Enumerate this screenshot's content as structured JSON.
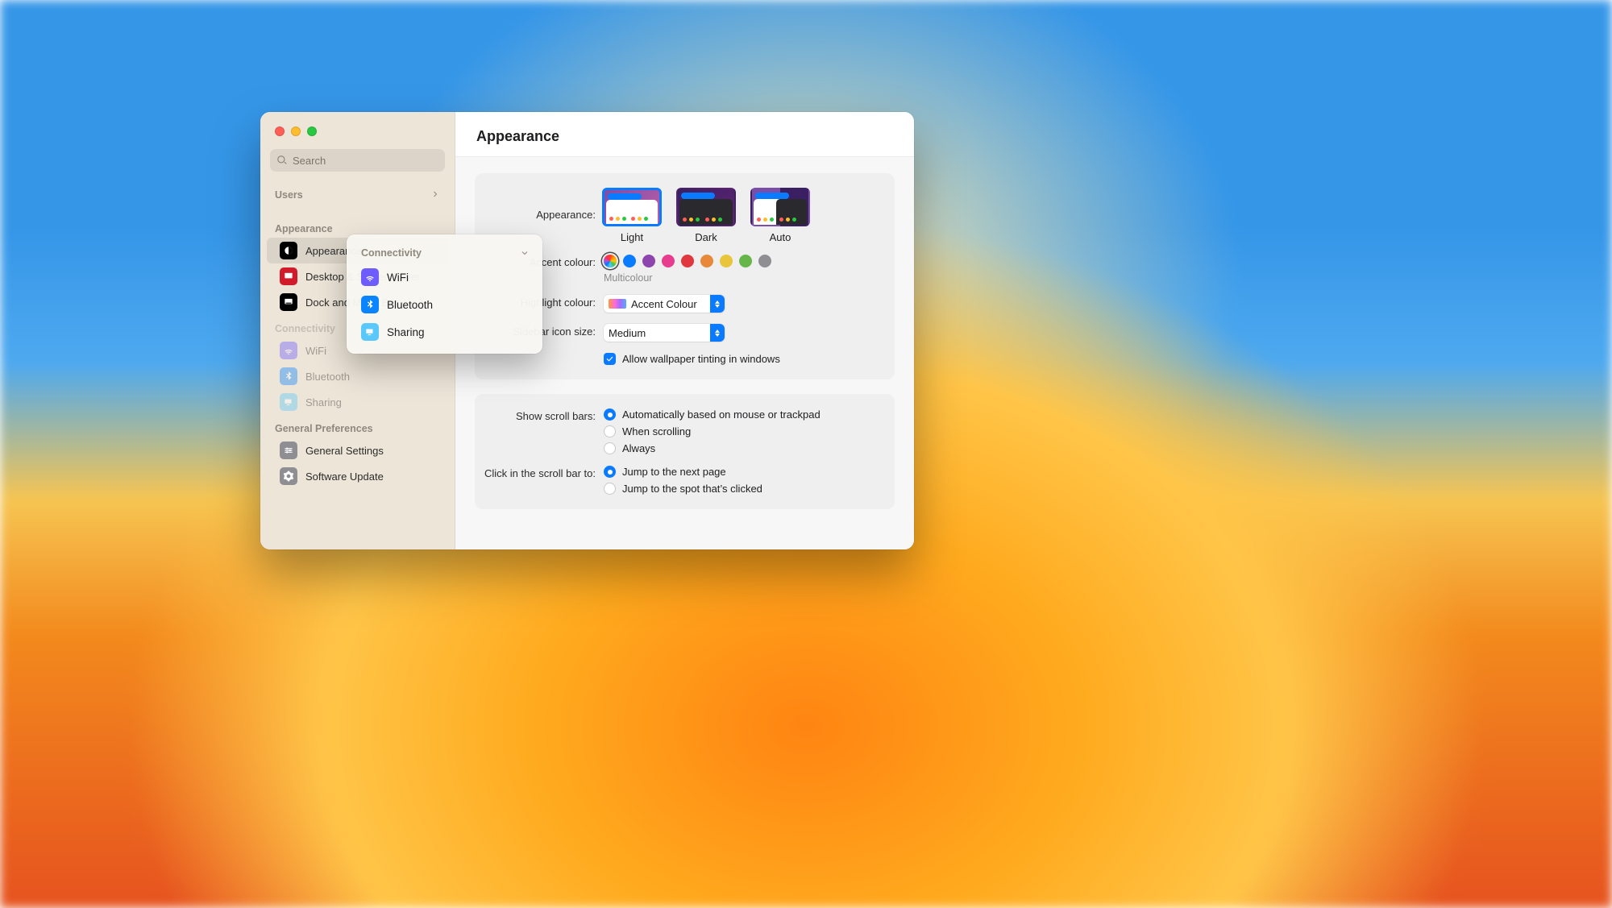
{
  "window": {
    "title": "Appearance"
  },
  "sidebar": {
    "search_placeholder": "Search",
    "users_header": "Users",
    "sections": {
      "appearance": {
        "header": "Appearance",
        "items": [
          {
            "label": "Appearance"
          },
          {
            "label": "Desktop & Screen Saver"
          },
          {
            "label": "Dock and Menu Bar"
          }
        ]
      },
      "connectivity": {
        "header": "Connectivity",
        "items": [
          {
            "label": "WiFi"
          },
          {
            "label": "Bluetooth"
          },
          {
            "label": "Sharing"
          }
        ]
      },
      "general": {
        "header": "General Preferences",
        "items": [
          {
            "label": "General Settings"
          },
          {
            "label": "Software Update"
          }
        ]
      }
    }
  },
  "popover": {
    "header": "Connectivity",
    "items": [
      {
        "label": "WiFi"
      },
      {
        "label": "Bluetooth"
      },
      {
        "label": "Sharing"
      }
    ]
  },
  "main": {
    "appearance_label": "Appearance:",
    "appearance_options": {
      "light": "Light",
      "dark": "Dark",
      "auto": "Auto"
    },
    "accent_label": "Accent colour:",
    "accent_value_name": "Multicolour",
    "accent_colours": [
      "#multicolour",
      "#0a7bff",
      "#8e44ad",
      "#e73c8f",
      "#e0383e",
      "#e8883a",
      "#e8c53a",
      "#67b64b",
      "#8e8e93"
    ],
    "highlight_label": "Highlight colour:",
    "highlight_value": "Accent Colour",
    "sidebaricon_label": "Sidebar icon size:",
    "sidebaricon_value": "Medium",
    "tint_label": "Allow wallpaper tinting in windows",
    "tint_checked": true,
    "scroll_label": "Show scroll bars:",
    "scroll_options": [
      {
        "label": "Automatically based on mouse or trackpad",
        "selected": true
      },
      {
        "label": "When scrolling",
        "selected": false
      },
      {
        "label": "Always",
        "selected": false
      }
    ],
    "click_label": "Click in the scroll bar to:",
    "click_options": [
      {
        "label": "Jump to the next page",
        "selected": true
      },
      {
        "label": "Jump to the spot that’s clicked",
        "selected": false
      }
    ]
  }
}
